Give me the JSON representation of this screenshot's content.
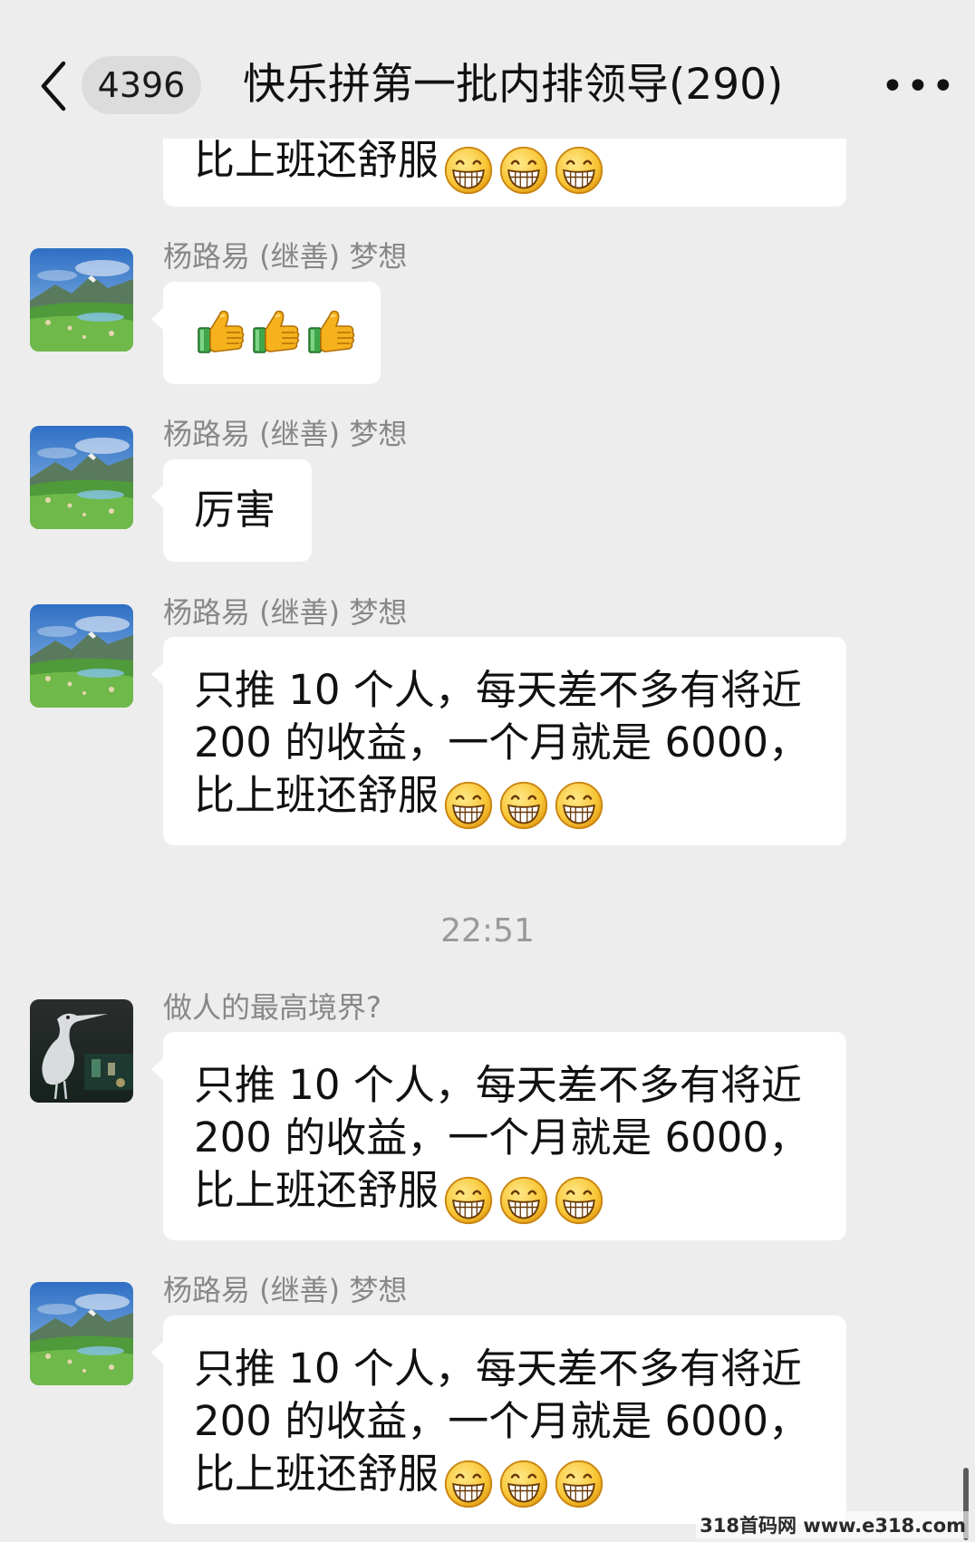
{
  "header": {
    "unread_count": "4396",
    "title": "快乐拼第一批内排领导(290)",
    "more_label": "•••",
    "icons": {
      "back": "chevron-left-icon",
      "more": "more-horizontal-icon"
    }
  },
  "messages": [
    {
      "partial": true,
      "text": "比上班还舒服"
    },
    {
      "sender": "杨路易 (继善) 梦想",
      "avatar": "landscape-avatar",
      "text": "",
      "emoji": [
        "thumbs-up-icon",
        "thumbs-up-icon",
        "thumbs-up-icon"
      ]
    },
    {
      "sender": "杨路易 (继善) 梦想",
      "avatar": "landscape-avatar",
      "text": "厉害"
    },
    {
      "sender": "杨路易 (继善) 梦想",
      "avatar": "landscape-avatar",
      "line1": "只推 10 个人，每天差不多有将近",
      "line2": "200 的收益，一个月就是 6000，",
      "line3": "比上班还舒服"
    },
    {
      "sender": "做人的最高境界?",
      "avatar": "heron-avatar",
      "line1": "只推 10 个人，每天差不多有将近",
      "line2": "200 的收益，一个月就是 6000，",
      "line3": "比上班还舒服"
    },
    {
      "sender": "杨路易 (继善) 梦想",
      "avatar": "landscape-avatar",
      "line1": "只推 10 个人，每天差不多有将近",
      "line2": "200 的收益，一个月就是 6000，",
      "line3": "比上班还舒服"
    }
  ],
  "timestamp": "22:51",
  "watermark": "318首码网 www.e318.com",
  "colors": {
    "background": "#ededed",
    "bubble": "#ffffff",
    "sender_name": "#888888",
    "timestamp": "#9a9a9a",
    "badge": "#dcdcdc"
  }
}
